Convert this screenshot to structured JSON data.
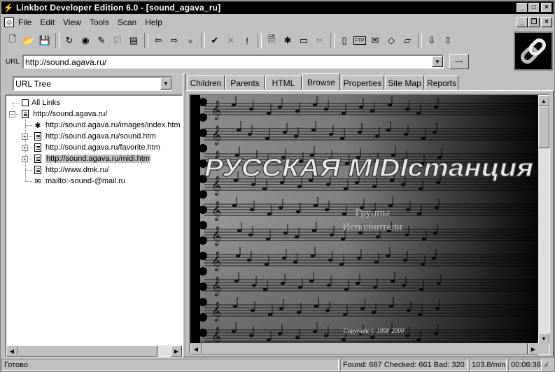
{
  "window": {
    "title": "Linkbot Developer Edition 6.0  - [sound_agava_ru]"
  },
  "menu": [
    "File",
    "Edit",
    "View",
    "Tools",
    "Scan",
    "Help"
  ],
  "toolbar": {
    "icons": [
      "new-file-icon",
      "open-folder-icon",
      "save-icon",
      "refresh-icon",
      "scan-icon",
      "edit-icon",
      "check-icon",
      "properties-icon",
      "back-arrow-icon",
      "forward-arrow-icon",
      "stop-icon",
      "checkmark-icon",
      "cross-icon",
      "exclamation-icon",
      "report-icon",
      "spider-icon",
      "window-icon",
      "scissors-icon",
      "page-icon",
      "ftp-icon",
      "mail-icon",
      "tag-icon",
      "folder-icon",
      "download-icon",
      "upload-icon"
    ]
  },
  "url_bar": {
    "label": "URL",
    "value": "http://sound.agava.ru/",
    "go_label": "···"
  },
  "left_pane": {
    "view_select": "URL Tree",
    "tree": [
      {
        "label": "All Links",
        "icon": "links-icon",
        "depth": 0,
        "expander": ""
      },
      {
        "label": "http://sound.agava.ru/",
        "icon": "page-icon",
        "depth": 0,
        "expander": "−"
      },
      {
        "label": "http://sound.agava.ru/images/index.htm",
        "icon": "spider-icon",
        "depth": 1,
        "expander": ""
      },
      {
        "label": "http://sound.agava.ru/sound.htm",
        "icon": "page-icon",
        "depth": 1,
        "expander": "+"
      },
      {
        "label": "http://sound.agava.ru/favorite.htm",
        "icon": "page-icon",
        "depth": 1,
        "expander": "+"
      },
      {
        "label": "http://sound.agava.ru/midi.htm",
        "icon": "page-icon",
        "depth": 1,
        "expander": "+",
        "selected": true
      },
      {
        "label": "http://www.dmk.ru/",
        "icon": "page-icon",
        "depth": 1,
        "expander": ""
      },
      {
        "label": "mailto:-sound-@mail.ru",
        "icon": "mail-icon",
        "depth": 1,
        "expander": ""
      }
    ]
  },
  "tabs": [
    {
      "label": "Children"
    },
    {
      "label": "Parents"
    },
    {
      "label": "HTML"
    },
    {
      "label": "Browse",
      "active": true
    },
    {
      "label": "Properties"
    },
    {
      "label": "Site Map"
    },
    {
      "label": "Reports"
    }
  ],
  "site": {
    "banner": "РУССКАЯ MIDIстанция",
    "link_groups": "Группы",
    "link_performers": "Исполнители",
    "copyright": "Copyright © 1998-2000"
  },
  "status": {
    "ready": "Готово",
    "counts": "Found: 687 Checked: 661 Bad: 320",
    "rate": "103.8/min",
    "elapsed": "00:06:36"
  }
}
